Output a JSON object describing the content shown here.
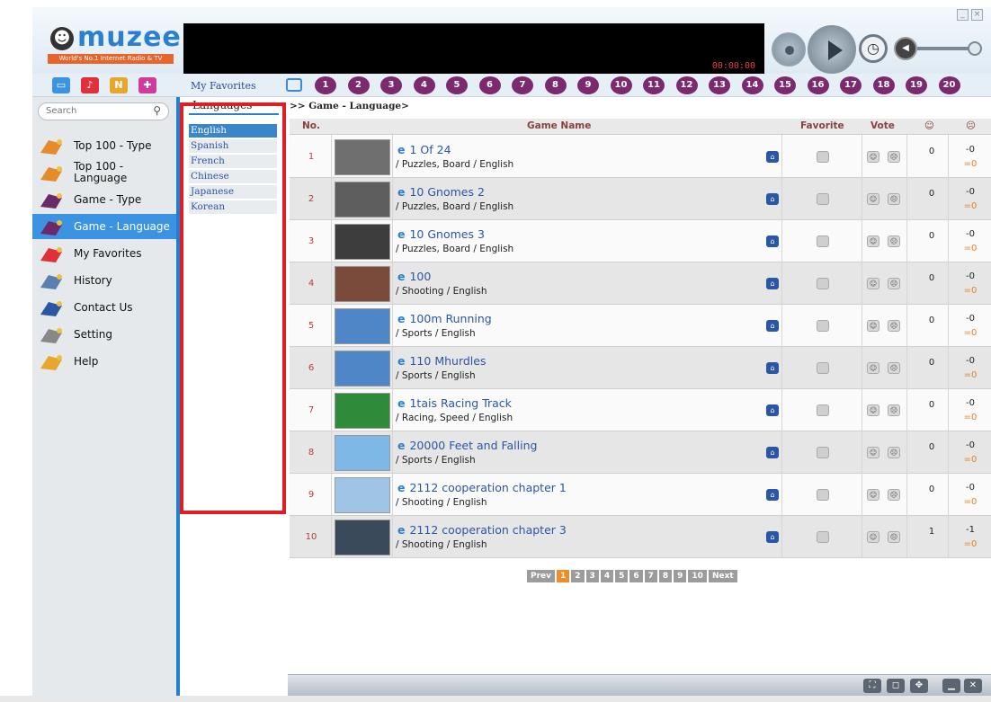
{
  "header": {
    "logo_text": "muzee",
    "logo_tagline": "World's No.1 Internet Radio & TV",
    "timer": "00:00:00"
  },
  "nav": {
    "my_favorites_tab": "My Favorites",
    "numbers": [
      "1",
      "2",
      "3",
      "4",
      "5",
      "6",
      "7",
      "8",
      "9",
      "10",
      "11",
      "12",
      "13",
      "14",
      "15",
      "16",
      "17",
      "18",
      "19",
      "20"
    ]
  },
  "sidebar": {
    "search_placeholder": "Search",
    "items": [
      {
        "label": "Top 100 - Type",
        "icon": "top100-type-icon",
        "color": "#e68a2e"
      },
      {
        "label": "Top 100 - Language",
        "icon": "top100-language-icon",
        "color": "#e68a2e"
      },
      {
        "label": "Game - Type",
        "icon": "game-type-icon",
        "color": "#6a2a6a"
      },
      {
        "label": "Game - Language",
        "icon": "game-language-icon",
        "color": "#6a2a6a"
      },
      {
        "label": "My Favorites",
        "icon": "heart-icon",
        "color": "#e0303a"
      },
      {
        "label": "History",
        "icon": "history-icon",
        "color": "#5b7fb0"
      },
      {
        "label": "Contact Us",
        "icon": "contact-icon",
        "color": "#2a56a6"
      },
      {
        "label": "Setting",
        "icon": "gear-icon",
        "color": "#888888"
      },
      {
        "label": "Help",
        "icon": "help-icon",
        "color": "#e6a72c"
      }
    ]
  },
  "languages": {
    "heading": "Languages",
    "items": [
      "English",
      "Spanish",
      "French",
      "Chinese",
      "Japanese",
      "Korean"
    ],
    "selected": "English"
  },
  "main": {
    "breadcrumb": ">> Game - Language>",
    "columns": {
      "no": "No.",
      "name": "Game Name",
      "favorite": "Favorite",
      "vote": "Vote",
      "good": "☺",
      "bad": "☹"
    },
    "rows": [
      {
        "no": "1",
        "name": "1 Of 24",
        "category": "/ Puzzles, Board / English",
        "good": "0",
        "bad": "-0",
        "bad2": "=0",
        "thumb": "#6f6f6f"
      },
      {
        "no": "2",
        "name": "10 Gnomes 2",
        "category": "/ Puzzles, Board / English",
        "good": "0",
        "bad": "-0",
        "bad2": "=0",
        "thumb": "#5e5e5e"
      },
      {
        "no": "3",
        "name": "10 Gnomes 3",
        "category": "/ Puzzles, Board / English",
        "good": "0",
        "bad": "-0",
        "bad2": "=0",
        "thumb": "#3d3d3d"
      },
      {
        "no": "4",
        "name": "100",
        "category": "/ Shooting / English",
        "good": "0",
        "bad": "-0",
        "bad2": "=0",
        "thumb": "#7a4a3a"
      },
      {
        "no": "5",
        "name": "100m Running",
        "category": "/ Sports / English",
        "good": "0",
        "bad": "-0",
        "bad2": "=0",
        "thumb": "#4e86c7"
      },
      {
        "no": "6",
        "name": "110 Mhurdles",
        "category": "/ Sports / English",
        "good": "0",
        "bad": "-0",
        "bad2": "=0",
        "thumb": "#4e86c7"
      },
      {
        "no": "7",
        "name": "1tais Racing Track",
        "category": "/ Racing, Speed / English",
        "good": "0",
        "bad": "-0",
        "bad2": "=0",
        "thumb": "#2f8a3a"
      },
      {
        "no": "8",
        "name": "20000 Feet and Falling",
        "category": "/ Sports / English",
        "good": "0",
        "bad": "-0",
        "bad2": "=0",
        "thumb": "#7db8e6"
      },
      {
        "no": "9",
        "name": "2112 cooperation chapter 1",
        "category": "/ Shooting / English",
        "good": "0",
        "bad": "-0",
        "bad2": "=0",
        "thumb": "#9fc4e6"
      },
      {
        "no": "10",
        "name": "2112 cooperation chapter 3",
        "category": "/ Shooting / English",
        "good": "1",
        "bad": "-1",
        "bad2": "=0",
        "thumb": "#3a4a5a"
      }
    ],
    "pager": {
      "prev": "Prev",
      "pages": [
        "1",
        "2",
        "3",
        "4",
        "5",
        "6",
        "7",
        "8",
        "9",
        "10"
      ],
      "current": "1",
      "next": "Next"
    }
  }
}
